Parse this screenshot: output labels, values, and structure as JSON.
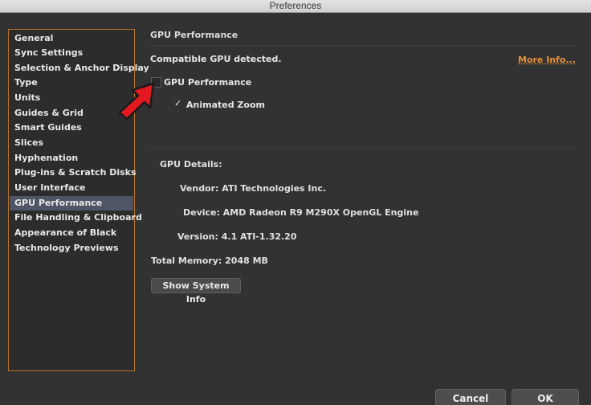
{
  "window": {
    "title": "Preferences"
  },
  "sidebar": {
    "items": [
      {
        "label": "General"
      },
      {
        "label": "Sync Settings"
      },
      {
        "label": "Selection & Anchor Display"
      },
      {
        "label": "Type"
      },
      {
        "label": "Units"
      },
      {
        "label": "Guides & Grid"
      },
      {
        "label": "Smart Guides"
      },
      {
        "label": "Slices"
      },
      {
        "label": "Hyphenation"
      },
      {
        "label": "Plug-ins & Scratch Disks"
      },
      {
        "label": "User Interface"
      },
      {
        "label": "GPU Performance",
        "selected": true
      },
      {
        "label": "File Handling & Clipboard"
      },
      {
        "label": "Appearance of Black"
      },
      {
        "label": "Technology Previews"
      }
    ]
  },
  "main": {
    "section_title": "GPU Performance",
    "compat_text": "Compatible GPU detected.",
    "more_info": "More Info...",
    "gpu_checkbox_label": "GPU Performance",
    "gpu_checkbox_checked": false,
    "animated_zoom_label": "Animated Zoom",
    "animated_zoom_checked": true,
    "check_glyph": "✓",
    "details": {
      "heading": "GPU Details:",
      "vendor": "Vendor: ATI Technologies Inc.",
      "device": "Device: AMD Radeon R9 M290X OpenGL Engine",
      "version": "Version: 4.1 ATI-1.32.20",
      "memory": "Total Memory: 2048 MB"
    },
    "show_system_info": "Show System Info"
  },
  "footer": {
    "cancel": "Cancel",
    "ok": "OK"
  },
  "colors": {
    "accent": "#e8913a",
    "selection": "#505565",
    "annotation_arrow": "#e3191f"
  },
  "icons": {
    "annotation": "red-arrow-icon"
  }
}
